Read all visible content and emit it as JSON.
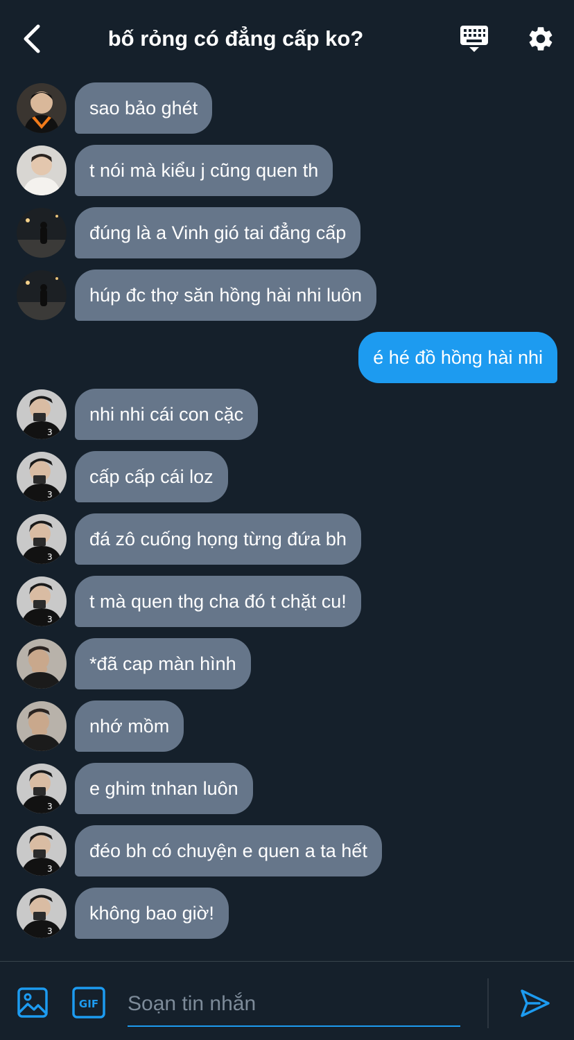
{
  "header": {
    "title": "bố rỏng có đẳng cấp ko?",
    "back_icon": "chevron-left-icon",
    "keyboard_icon": "keyboard-icon",
    "settings_icon": "gear-icon"
  },
  "messages": [
    {
      "text": "sao bảo ghét",
      "sender": "other",
      "avatar": "avatar-1"
    },
    {
      "text": "t nói mà kiểu j cũng quen th",
      "sender": "other",
      "avatar": "avatar-2"
    },
    {
      "text": "đúng là a Vinh gió tai đẳng cấp",
      "sender": "other",
      "avatar": "avatar-3"
    },
    {
      "text": "húp đc thợ săn hồng hài nhi luôn",
      "sender": "other",
      "avatar": "avatar-3"
    },
    {
      "text": "é hé đồ hồng hài nhi",
      "sender": "me"
    },
    {
      "text": "nhi nhi cái con cặc",
      "sender": "other",
      "avatar": "avatar-4"
    },
    {
      "text": "cấp cấp cái loz",
      "sender": "other",
      "avatar": "avatar-4"
    },
    {
      "text": "đá zô cuống họng từng đứa bh",
      "sender": "other",
      "avatar": "avatar-4"
    },
    {
      "text": "t mà quen thg cha đó t chặt cu!",
      "sender": "other",
      "avatar": "avatar-4"
    },
    {
      "text": "*đã cap màn hình",
      "sender": "other",
      "avatar": "avatar-5"
    },
    {
      "text": "nhớ mồm",
      "sender": "other",
      "avatar": "avatar-5"
    },
    {
      "text": "e ghim tnhan luôn",
      "sender": "other",
      "avatar": "avatar-4"
    },
    {
      "text": "đéo bh có chuyện e quen a ta hết",
      "sender": "other",
      "avatar": "avatar-4"
    },
    {
      "text": "không bao giờ!",
      "sender": "other",
      "avatar": "avatar-4"
    }
  ],
  "composer": {
    "placeholder": "Soạn tin nhắn",
    "value": "",
    "media_icon": "image-icon",
    "gif_label": "GIF",
    "send_icon": "send-icon"
  },
  "colors": {
    "background": "#15202b",
    "received_bubble": "#66768a",
    "sent_bubble": "#1d9bf0",
    "accent": "#1d9bf0"
  }
}
